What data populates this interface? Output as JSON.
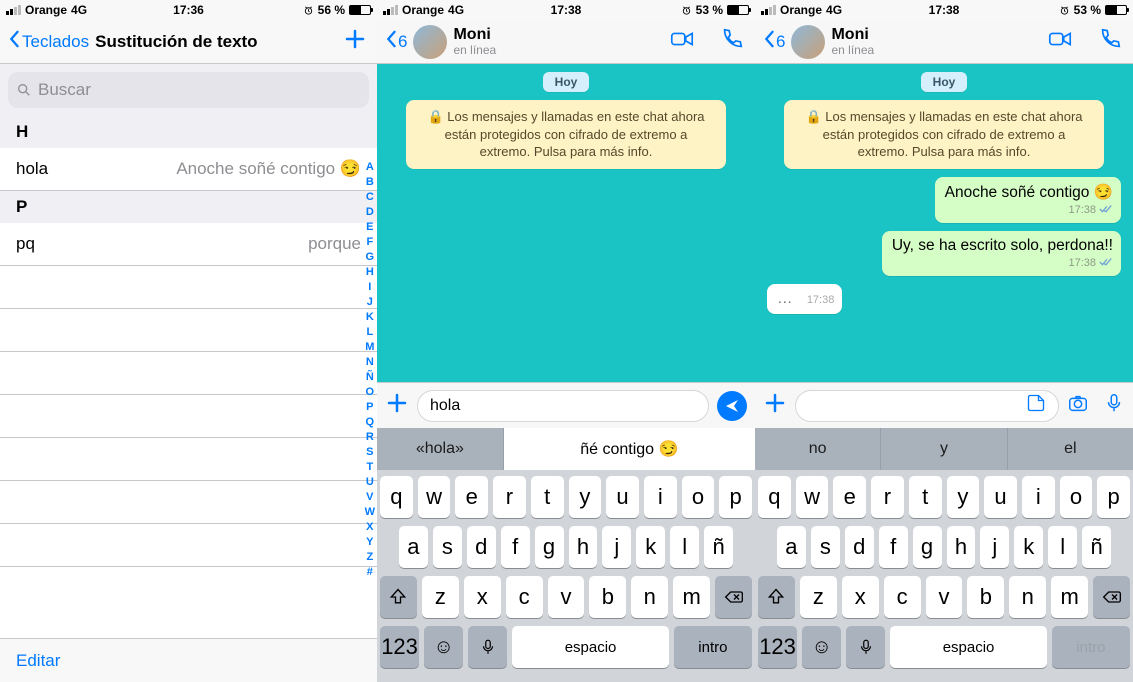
{
  "panes": {
    "settings": {
      "status": {
        "carrier": "Orange",
        "net": "4G",
        "time": "17:36",
        "battery": "56 %"
      },
      "back": "Teclados",
      "title": "Sustitución de texto",
      "search_placeholder": "Buscar",
      "sections": [
        {
          "header": "H",
          "rows": [
            {
              "k": "hola",
              "v": "Anoche soñé contigo 😏"
            }
          ]
        },
        {
          "header": "P",
          "rows": [
            {
              "k": "pq",
              "v": "porque"
            }
          ]
        }
      ],
      "index": [
        "A",
        "B",
        "C",
        "D",
        "E",
        "F",
        "G",
        "H",
        "I",
        "J",
        "K",
        "L",
        "M",
        "N",
        "Ñ",
        "O",
        "P",
        "Q",
        "R",
        "S",
        "T",
        "U",
        "V",
        "W",
        "X",
        "Y",
        "Z",
        "#"
      ],
      "edit": "Editar"
    },
    "chat_a": {
      "status": {
        "carrier": "Orange",
        "net": "4G",
        "time": "17:38",
        "battery": "53 %"
      },
      "back_count": "6",
      "name": "Moni",
      "presence": "en línea",
      "day": "Hoy",
      "encryption": "🔒 Los mensajes y llamadas en este chat ahora están protegidos con cifrado de extremo a extremo. Pulsa para más info.",
      "input_value": "hola",
      "suggestions": [
        "«hola»",
        "ñé contigo 😏"
      ],
      "keyboard": {
        "rows": [
          [
            "q",
            "w",
            "e",
            "r",
            "t",
            "y",
            "u",
            "i",
            "o",
            "p"
          ],
          [
            "a",
            "s",
            "d",
            "f",
            "g",
            "h",
            "j",
            "k",
            "l",
            "ñ"
          ],
          [
            "z",
            "x",
            "c",
            "v",
            "b",
            "n",
            "m"
          ]
        ],
        "numkey": "123",
        "space": "espacio",
        "enter": "intro"
      }
    },
    "chat_b": {
      "status": {
        "carrier": "Orange",
        "net": "4G",
        "time": "17:38",
        "battery": "53 %"
      },
      "back_count": "6",
      "name": "Moni",
      "presence": "en línea",
      "day": "Hoy",
      "encryption": "🔒 Los mensajes y llamadas en este chat ahora están protegidos con cifrado de extremo a extremo. Pulsa para más info.",
      "messages": [
        {
          "dir": "out",
          "text": "Anoche soñé contigo 😏",
          "time": "17:38"
        },
        {
          "dir": "out",
          "text": "Uy, se ha escrito solo, perdona!!",
          "time": "17:38"
        },
        {
          "dir": "in",
          "text": "…",
          "time": "17:38"
        }
      ],
      "input_value": "",
      "suggestions": [
        "no",
        "y",
        "el"
      ],
      "keyboard": {
        "rows": [
          [
            "q",
            "w",
            "e",
            "r",
            "t",
            "y",
            "u",
            "i",
            "o",
            "p"
          ],
          [
            "a",
            "s",
            "d",
            "f",
            "g",
            "h",
            "j",
            "k",
            "l",
            "ñ"
          ],
          [
            "z",
            "x",
            "c",
            "v",
            "b",
            "n",
            "m"
          ]
        ],
        "numkey": "123",
        "space": "espacio",
        "enter": "intro"
      }
    }
  }
}
